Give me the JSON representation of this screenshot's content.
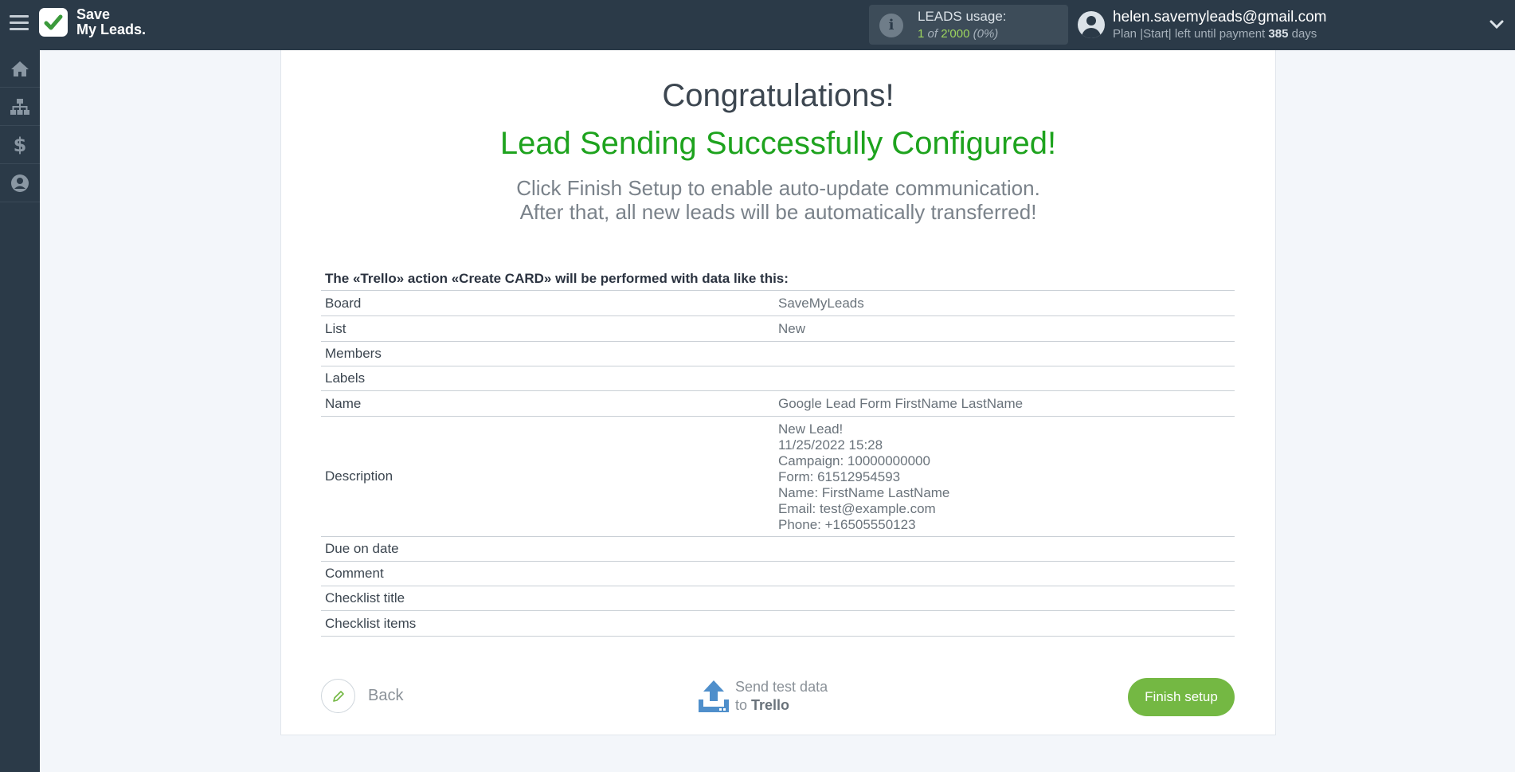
{
  "header": {
    "logo_text": "Save\nMy Leads.",
    "usage": {
      "label": "LEADS usage:",
      "used": "1",
      "of": "of",
      "total": "2'000",
      "percent": "(0%)"
    },
    "user": {
      "email": "helen.savemyleads@gmail.com",
      "plan_prefix": "Plan |Start| left until payment",
      "days": "385",
      "days_suffix": "days"
    }
  },
  "sidebar": {
    "items": [
      "home-icon",
      "sitemap-icon",
      "dollar-icon",
      "user-circle-icon"
    ]
  },
  "main": {
    "congrats": "Congratulations!",
    "success": "Lead Sending Successfully Configured!",
    "hint_line1": "Click Finish Setup to enable auto-update communication.",
    "hint_line2": "After that, all new leads will be automatically transferred!",
    "table_caption": "The «Trello» action «Create CARD» will be performed with data like this:",
    "rows": [
      {
        "key": "Board",
        "value": "SaveMyLeads"
      },
      {
        "key": "List",
        "value": "New"
      },
      {
        "key": "Members",
        "value": ""
      },
      {
        "key": "Labels",
        "value": ""
      },
      {
        "key": "Name",
        "value": "Google Lead Form FirstName LastName"
      },
      {
        "key": "Description",
        "value": "New Lead!\n11/25/2022 15:28\nCampaign: 10000000000\nForm: 61512954593\nName: FirstName LastName\nEmail: test@example.com\nPhone: +16505550123"
      },
      {
        "key": "Due on date",
        "value": ""
      },
      {
        "key": "Comment",
        "value": ""
      },
      {
        "key": "Checklist title",
        "value": ""
      },
      {
        "key": "Checklist items",
        "value": ""
      }
    ],
    "back_label": "Back",
    "send_line1": "Send test data",
    "send_to": "to",
    "send_target": "Trello",
    "finish_label": "Finish setup"
  },
  "colors": {
    "topbar": "#2b3a48",
    "success_green": "#1ea31e",
    "finish_button": "#74b843",
    "usage_green": "#9dd45e",
    "send_icon_blue": "#4f8fcb"
  }
}
